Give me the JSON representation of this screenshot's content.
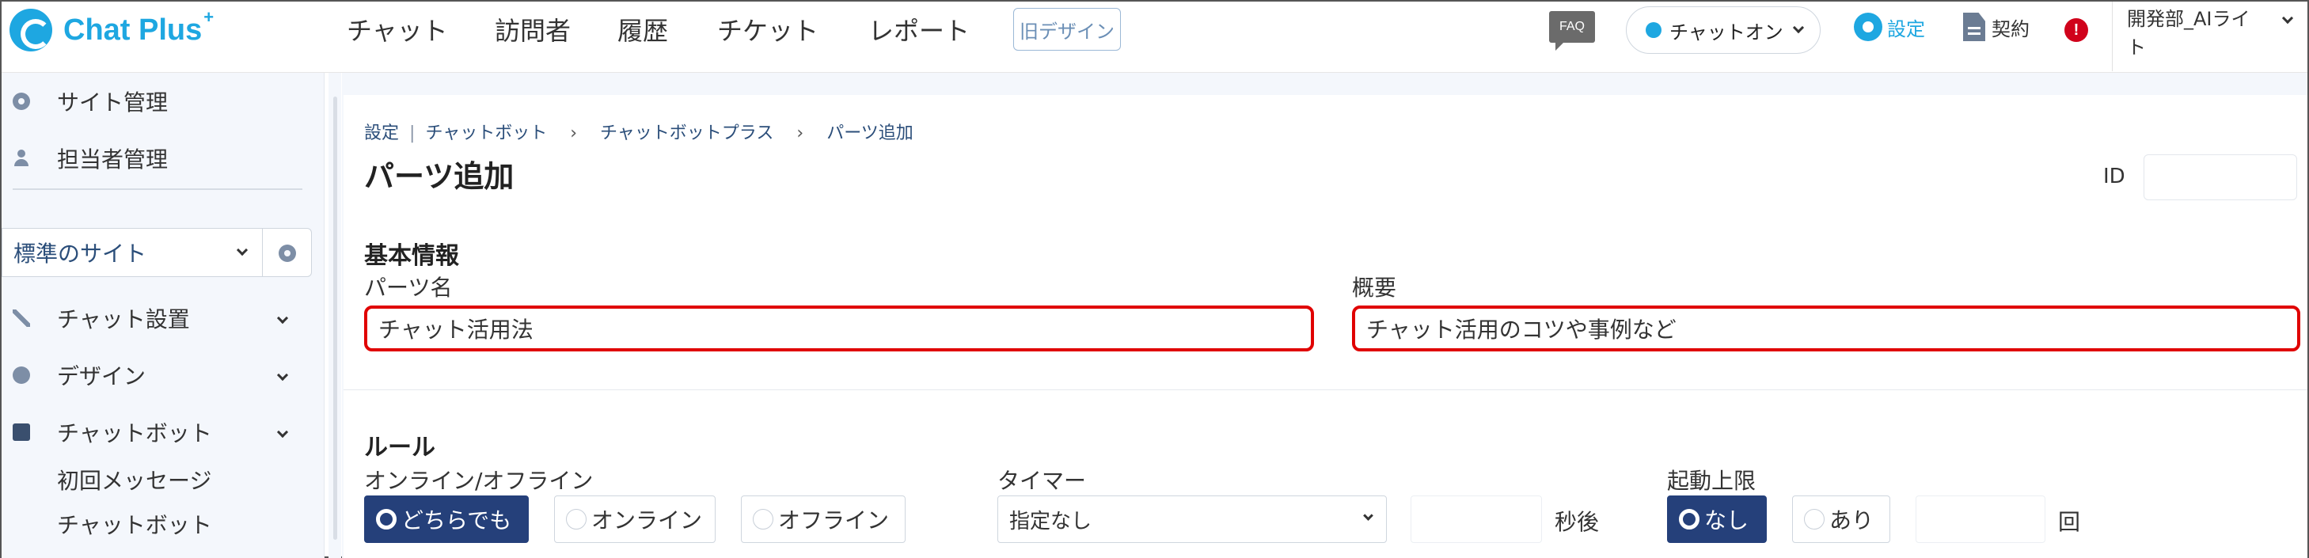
{
  "header": {
    "logo_text": "Chat Plus",
    "logo_sup": "+",
    "nav": [
      "チャット",
      "訪問者",
      "履歴",
      "チケット",
      "レポート"
    ],
    "old_design_label": "旧デザイン",
    "faq_label": "FAQ",
    "status_label": "チャットオン",
    "settings_label": "設定",
    "contract_label": "契約",
    "alert_glyph": "!",
    "user_line1": "開発部_AIライ",
    "user_line2": "ト"
  },
  "sidebar": {
    "top_items": [
      "サイト管理",
      "担当者管理"
    ],
    "site_select": "標準のサイト",
    "groups": [
      "チャット設置",
      "デザイン",
      "チャットボット"
    ],
    "sub_items": [
      "初回メッセージ",
      "チャットボット"
    ]
  },
  "breadcrumb": {
    "root": "設定",
    "items": [
      "チャットボット",
      "チャットボットプラス",
      "パーツ追加"
    ]
  },
  "page": {
    "title": "パーツ追加",
    "id_label": "ID",
    "id_value": ""
  },
  "basic": {
    "heading": "基本情報",
    "name_label": "パーツ名",
    "name_value": "チャット活用法",
    "summary_label": "概要",
    "summary_value": "チャット活用のコツや事例など"
  },
  "rules": {
    "heading": "ルール",
    "online_label": "オンライン/オフライン",
    "online_options": [
      "どちらでも",
      "オンライン",
      "オフライン"
    ],
    "online_selected": "どちらでも",
    "timer_label": "タイマー",
    "timer_value": "指定なし",
    "timer_unit": "秒後",
    "limit_label": "起動上限",
    "limit_options": [
      "なし",
      "あり"
    ],
    "limit_selected": "なし",
    "limit_unit": "回"
  },
  "colors": {
    "brand": "#1ea7e1",
    "navy": "#25407a",
    "highlight_border": "#e00000"
  }
}
